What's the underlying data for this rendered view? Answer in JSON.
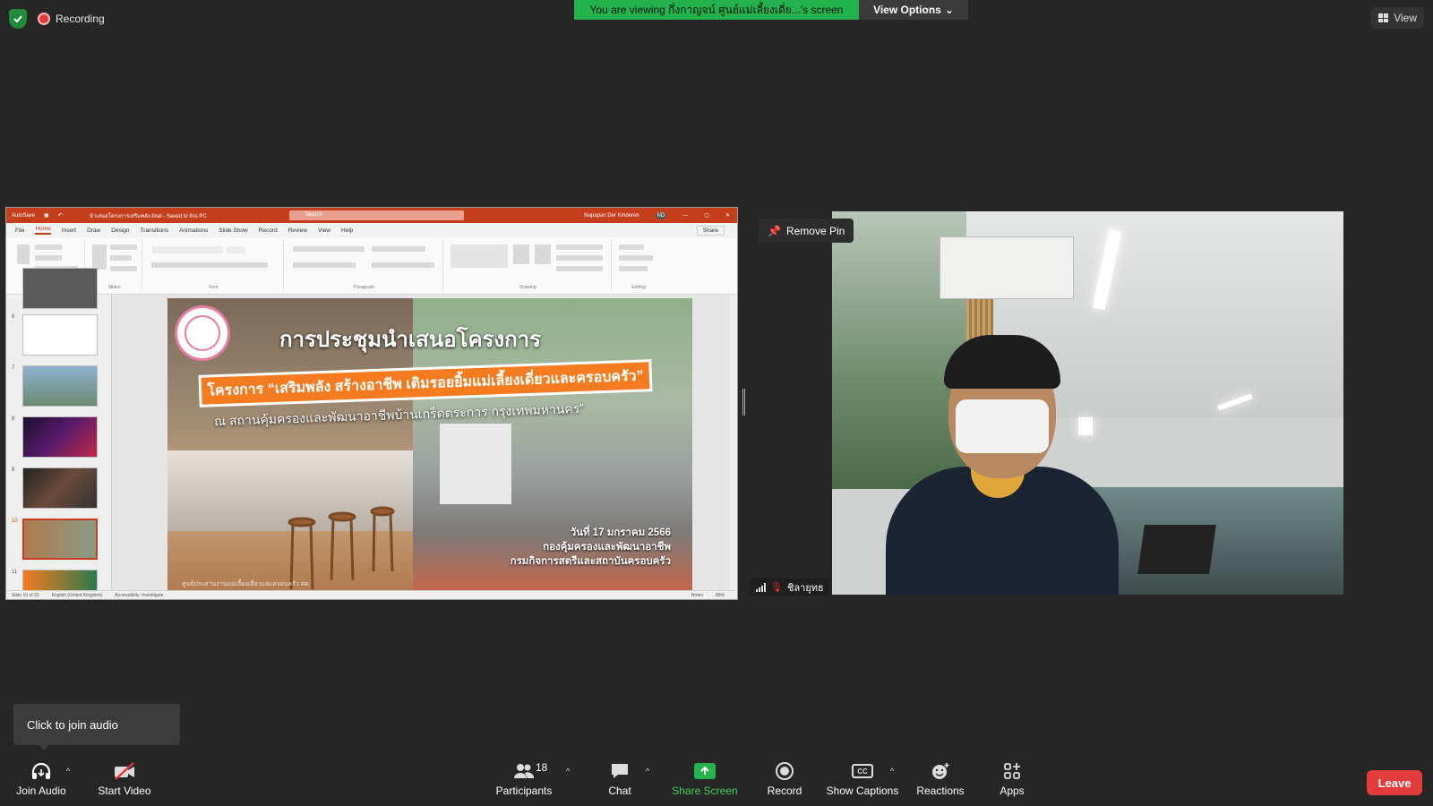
{
  "top": {
    "recording_label": "Recording",
    "viewing_banner": "You are viewing กึ่งกาญจน์ ศูนย์แม่เลี้ยงเดี่ย...'s screen",
    "view_options_label": "View Options",
    "view_label": "View"
  },
  "ppt": {
    "title_autosave": "AutoSave",
    "title_file": "นำเสนอโครงการเสริมพลัง-final - Saved to this PC",
    "search_placeholder": "Search",
    "user_name": "Napapan Der Kinderen",
    "user_initials": "ND",
    "share_label": "Share",
    "tabs": [
      "File",
      "Home",
      "Insert",
      "Draw",
      "Design",
      "Transitions",
      "Animations",
      "Slide Show",
      "Record",
      "Review",
      "View",
      "Help"
    ],
    "active_tab": "Home",
    "ribbon_groups": [
      "Clipboard",
      "Slides",
      "Font",
      "Paragraph",
      "Drawing",
      "Editing"
    ],
    "thumb_numbers": [
      "6",
      "7",
      "8",
      "9",
      "10",
      "11"
    ],
    "status_slide": "Slide 10 of 23",
    "status_lang": "English (United Kingdom)",
    "status_access": "Accessibility: Investigate",
    "status_notes": "Notes",
    "status_zoom": "86%"
  },
  "slide": {
    "title": "การประชุมนำเสนอโครงการ",
    "banner": "โครงการ “เสริมพลัง สร้างอาชีพ เติมรอยยิ้มแม่เลี้ยงเดี่ยวและครอบครัว”",
    "subtitle": "ณ สถานคุ้มครองและพัฒนาอาชีพบ้านเกร็ดตระการ กรุงเทพมหานคร”",
    "date": "วันที่ 17 มกราคม 2566",
    "org1": "กองคุ้มครองและพัฒนาอาชีพ",
    "org2": "กรมกิจการสตรีและสถาบันครอบครัว",
    "footer": "ศูนย์ประสานงานแม่เลี้ยงเดี่ยวและครอบครัว ศค."
  },
  "video": {
    "remove_pin_label": "Remove Pin",
    "participant_name": "ชิลายุทธ"
  },
  "tooltip": {
    "join_audio": "Click to join audio"
  },
  "toolbar": {
    "join_audio": "Join Audio",
    "start_video": "Start Video",
    "participants": "Participants",
    "participants_count": "18",
    "chat": "Chat",
    "share_screen": "Share Screen",
    "record": "Record",
    "show_captions": "Show Captions",
    "captions_icon_text": "CC",
    "reactions": "Reactions",
    "apps": "Apps",
    "leave": "Leave"
  },
  "colors": {
    "banner_green": "#24b24c",
    "leave_red": "#e23c3c",
    "ppt_accent": "#c43e1c",
    "slide_orange": "#f47b20"
  }
}
